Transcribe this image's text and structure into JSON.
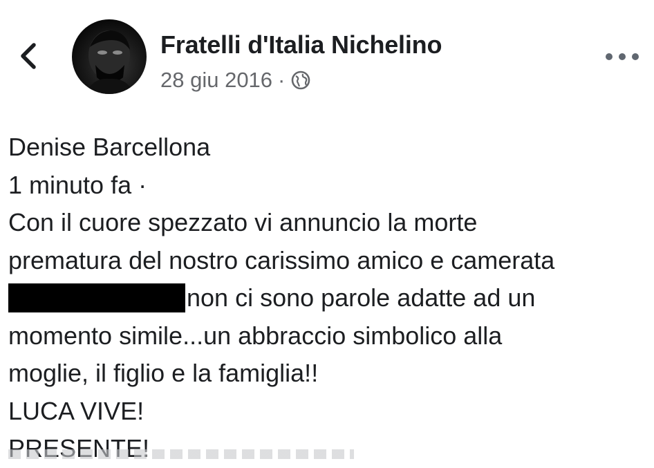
{
  "header": {
    "back_icon": "chevron-left-icon",
    "avatar_icon": "profile-avatar",
    "page_name": "Fratelli d'Italia Nichelino",
    "date": "28 giu 2016",
    "separator": "·",
    "privacy_icon": "globe-icon",
    "more_icon": "more-horizontal-icon"
  },
  "post": {
    "author": "Denise Barcellona",
    "time": "1 minuto fa ·",
    "lines": [
      "Con il cuore spezzato vi annuncio la morte",
      "prematura del nostro carissimo amico e camerata",
      "non ci sono parole adatte ad un",
      "momento simile...un abbraccio simbolico alla",
      "moglie, il figlio e la famiglia!!",
      "LUCA VIVE!",
      "PRESENTE!"
    ]
  },
  "colors": {
    "text": "#1c1e21",
    "meta": "#65676b",
    "icons": "#606770",
    "redaction": "#000000"
  }
}
